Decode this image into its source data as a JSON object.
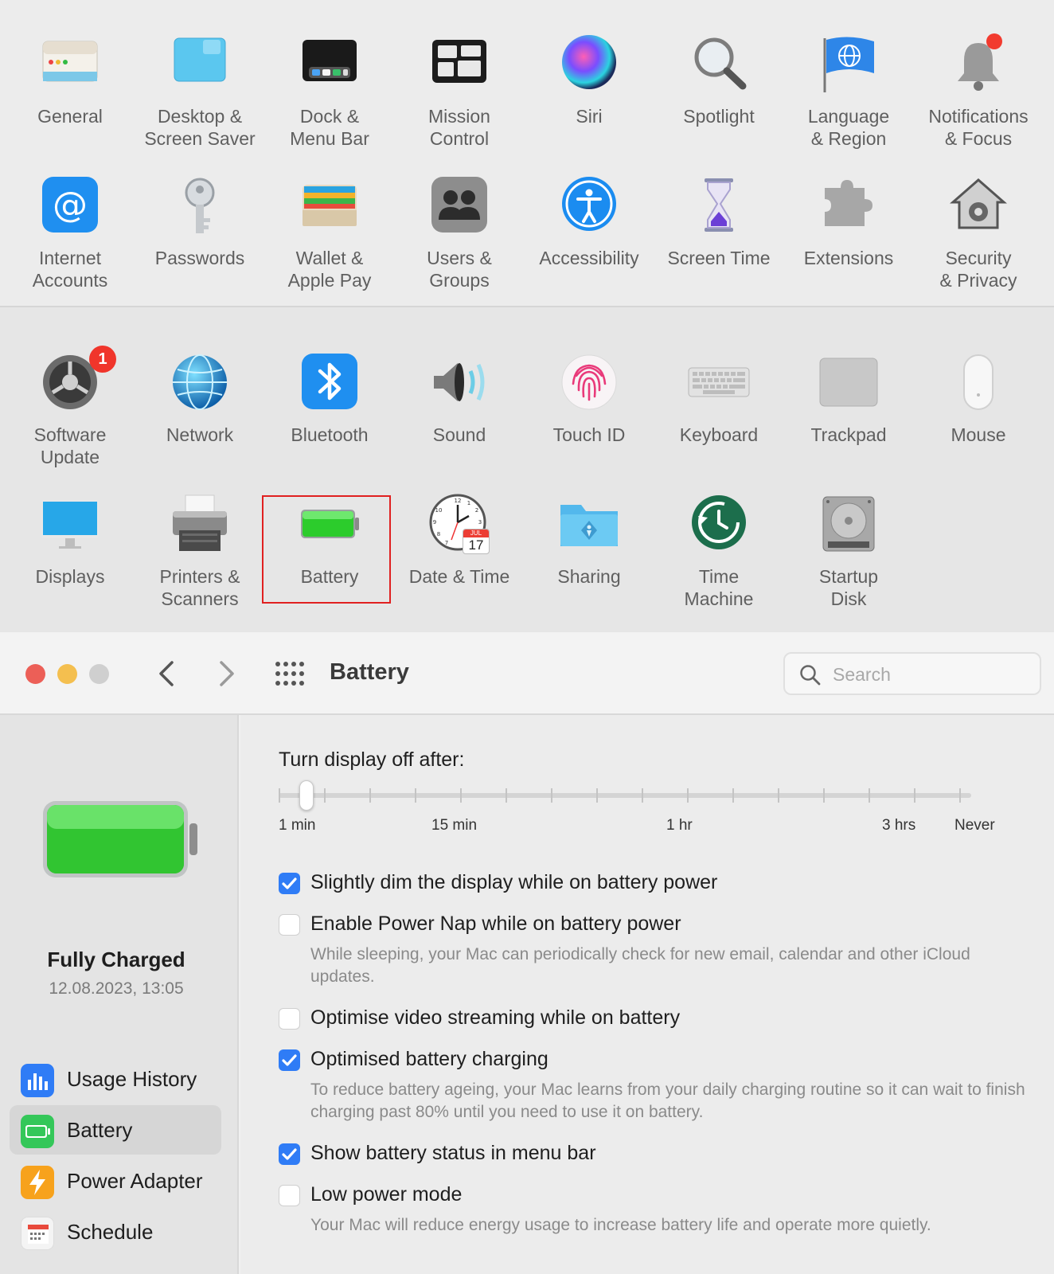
{
  "preferences": {
    "row1": [
      {
        "label": "General",
        "icon": "general-icon"
      },
      {
        "label": "Desktop &\nScreen Saver",
        "icon": "desktop-icon"
      },
      {
        "label": "Dock &\nMenu Bar",
        "icon": "dock-icon"
      },
      {
        "label": "Mission\nControl",
        "icon": "mission-control-icon"
      },
      {
        "label": "Siri",
        "icon": "siri-icon"
      },
      {
        "label": "Spotlight",
        "icon": "spotlight-icon"
      },
      {
        "label": "Language\n& Region",
        "icon": "language-icon"
      },
      {
        "label": "Notifications\n& Focus",
        "icon": "notifications-icon"
      }
    ],
    "row2": [
      {
        "label": "Internet\nAccounts",
        "icon": "internet-accounts-icon"
      },
      {
        "label": "Passwords",
        "icon": "passwords-icon"
      },
      {
        "label": "Wallet &\nApple Pay",
        "icon": "wallet-icon"
      },
      {
        "label": "Users &\nGroups",
        "icon": "users-icon"
      },
      {
        "label": "Accessibility",
        "icon": "accessibility-icon"
      },
      {
        "label": "Screen Time",
        "icon": "screen-time-icon"
      },
      {
        "label": "Extensions",
        "icon": "extensions-icon"
      },
      {
        "label": "Security\n& Privacy",
        "icon": "security-icon"
      }
    ],
    "row3": [
      {
        "label": "Software\nUpdate",
        "icon": "software-update-icon",
        "badge": "1"
      },
      {
        "label": "Network",
        "icon": "network-icon"
      },
      {
        "label": "Bluetooth",
        "icon": "bluetooth-icon"
      },
      {
        "label": "Sound",
        "icon": "sound-icon"
      },
      {
        "label": "Touch ID",
        "icon": "touch-id-icon"
      },
      {
        "label": "Keyboard",
        "icon": "keyboard-icon"
      },
      {
        "label": "Trackpad",
        "icon": "trackpad-icon"
      },
      {
        "label": "Mouse",
        "icon": "mouse-icon"
      }
    ],
    "row4": [
      {
        "label": "Displays",
        "icon": "displays-icon"
      },
      {
        "label": "Printers &\nScanners",
        "icon": "printers-icon"
      },
      {
        "label": "Battery",
        "icon": "battery-icon"
      },
      {
        "label": "Date & Time",
        "icon": "date-time-icon",
        "calendar_month": "JUL",
        "calendar_day": "17"
      },
      {
        "label": "Sharing",
        "icon": "sharing-icon"
      },
      {
        "label": "Time\nMachine",
        "icon": "time-machine-icon"
      },
      {
        "label": "Startup\nDisk",
        "icon": "startup-disk-icon"
      }
    ]
  },
  "window": {
    "title": "Battery",
    "search_placeholder": "Search"
  },
  "status": {
    "title": "Fully Charged",
    "timestamp": "12.08.2023, 13:05",
    "level": 1.0
  },
  "sidebar": {
    "items": [
      {
        "label": "Usage History",
        "icon": "usage-history-icon",
        "color": "#2f7cf6"
      },
      {
        "label": "Battery",
        "icon": "battery-small-icon",
        "color": "#34c759",
        "selected": true
      },
      {
        "label": "Power Adapter",
        "icon": "power-adapter-icon",
        "color": "#f7a21c"
      },
      {
        "label": "Schedule",
        "icon": "schedule-icon",
        "color": "#e84a3c"
      }
    ]
  },
  "slider": {
    "label": "Turn display off after:",
    "tick_labels": [
      "1 min",
      "15 min",
      "1 hr",
      "3 hrs",
      "Never"
    ],
    "ticks": 16,
    "value_index": 0
  },
  "options": [
    {
      "label": "Slightly dim the display while on battery power",
      "checked": true
    },
    {
      "label": "Enable Power Nap while on battery power",
      "checked": false,
      "description": "While sleeping, your Mac can periodically check for new email, calendar and other iCloud updates."
    },
    {
      "label": "Optimise video streaming while on battery",
      "checked": false
    },
    {
      "label": "Optimised battery charging",
      "checked": true,
      "description": "To reduce battery ageing, your Mac learns from your daily charging routine so it can wait to finish charging past 80% until you need to use it on battery."
    },
    {
      "label": "Show battery status in menu bar",
      "checked": true
    },
    {
      "label": "Low power mode",
      "checked": false,
      "description": "Your Mac will reduce energy usage to increase battery life and operate more quietly."
    }
  ],
  "colors": {
    "accent": "#2f7cf6",
    "battery_green": "#34c759",
    "close": "#ec5f57",
    "minimize": "#f4bf4f",
    "zoom": "#cfcfcf",
    "highlight": "#e02020"
  }
}
